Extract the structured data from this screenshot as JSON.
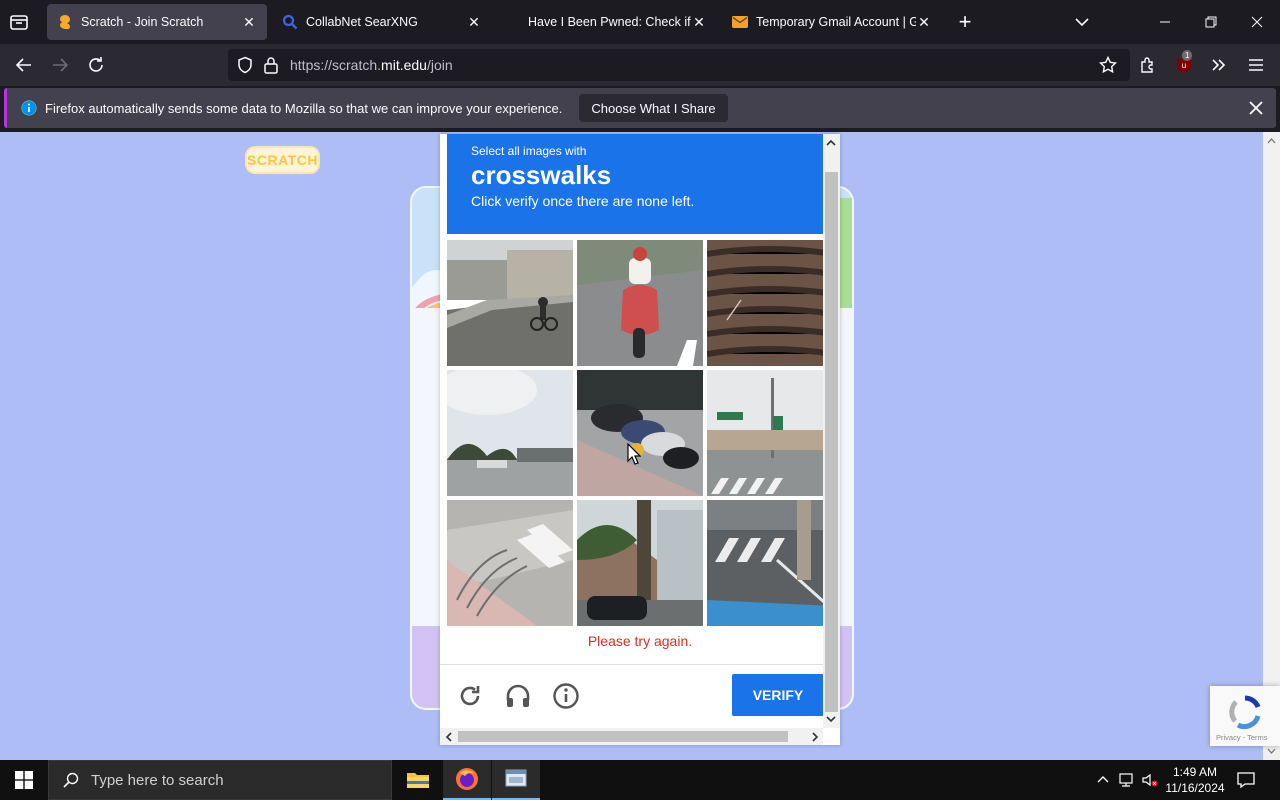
{
  "browser": {
    "tabs": [
      {
        "title": "Scratch - Join Scratch",
        "active": true,
        "icon": "scratch-favicon"
      },
      {
        "title": "CollabNet SearXNG",
        "active": false,
        "icon": "search-favicon"
      },
      {
        "title": "Have I Been Pwned: Check if yo",
        "active": false,
        "icon": ""
      },
      {
        "title": "Temporary Gmail Account | Gm",
        "active": false,
        "icon": "mail-favicon"
      }
    ],
    "url_prefix": "https://scratch.",
    "url_host": "mit.edu",
    "url_path": "/join",
    "extension_badge": "1",
    "accent": "#b833e1"
  },
  "notification": {
    "message": "Firefox automatically sends some data to Mozilla so that we can improve your experience.",
    "button": "Choose What I Share"
  },
  "page": {
    "logo_text": "SCRATCH",
    "background": "#aebdf5"
  },
  "captcha": {
    "instruction_prefix": "Select all images with",
    "target": "crosswalks",
    "instruction_suffix": "Click verify once there are none left.",
    "error": "Please try again.",
    "verify_label": "VERIFY",
    "header_color": "#1a73e8",
    "tiles": [
      "street-cyclist",
      "red-scooter-rider",
      "wooden-stairs",
      "sky-parking-lot",
      "parked-motorcycles",
      "intersection-crosswalk",
      "bike-rack-crosswalk",
      "house-trees-car",
      "road-crosswalk"
    ]
  },
  "recaptcha_badge": {
    "links": "Privacy - Terms"
  },
  "taskbar": {
    "search_placeholder": "Type here to search",
    "time": "1:49 AM",
    "date": "11/16/2024"
  }
}
